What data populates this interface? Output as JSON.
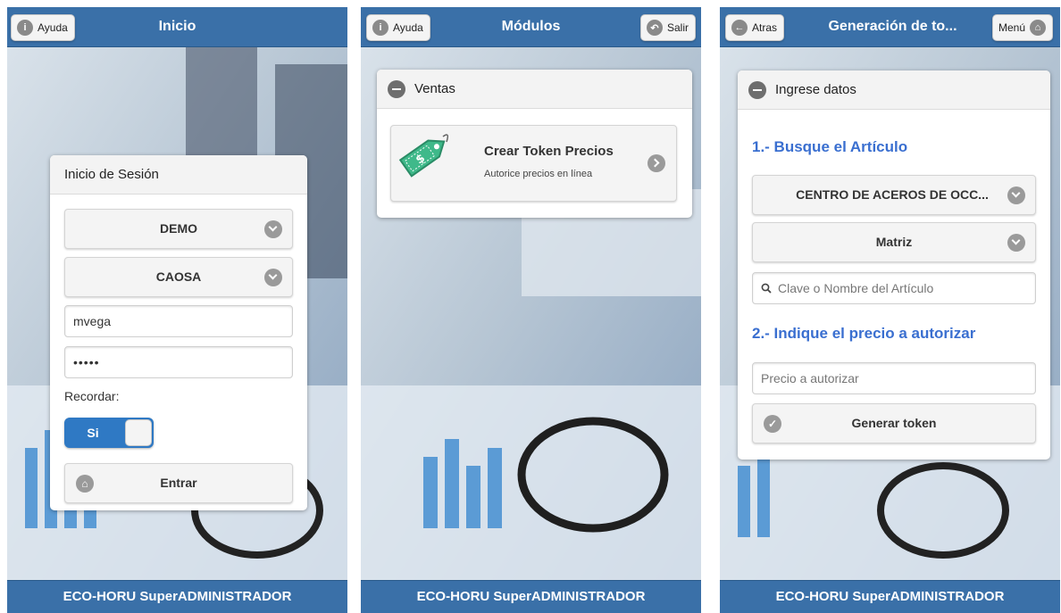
{
  "screens": [
    {
      "header": {
        "title": "Inicio",
        "left_button": {
          "label": "Ayuda",
          "icon": "info-icon"
        }
      },
      "login": {
        "title": "Inicio de Sesión",
        "company_select": "DEMO",
        "branch_select": "CAOSA",
        "username_value": "mvega",
        "password_value": "•••••",
        "remember_label": "Recordar:",
        "remember_toggle": "Si",
        "submit_label": "Entrar"
      },
      "footer": "ECO-HORU SuperADMINISTRADOR"
    },
    {
      "header": {
        "title": "Módulos",
        "left_button": {
          "label": "Ayuda",
          "icon": "info-icon"
        },
        "right_button": {
          "label": "Salir",
          "icon": "exit-icon"
        }
      },
      "section": {
        "title": "Ventas",
        "item": {
          "title": "Crear Token Precios",
          "subtitle": "Autorice precios en línea",
          "icon": "price-tag-icon"
        }
      },
      "footer": "ECO-HORU SuperADMINISTRADOR"
    },
    {
      "header": {
        "title": "Generación de to...",
        "left_button": {
          "label": "Atras",
          "icon": "arrow-left-icon"
        },
        "right_button": {
          "label": "Menú",
          "icon": "home-icon"
        }
      },
      "form": {
        "section_title": "Ingrese datos",
        "step1": "1.- Busque el Artículo",
        "company_select": "CENTRO DE ACEROS DE OCC...",
        "branch_select": "Matriz",
        "search_placeholder": "Clave o Nombre del Artículo",
        "step2": "2.- Indique el precio a autorizar",
        "price_placeholder": "Precio a autorizar",
        "generate_label": "Generar token"
      },
      "footer": "ECO-HORU SuperADMINISTRADOR"
    }
  ],
  "colors": {
    "header": "#3a70a8",
    "accent_blue": "#3a6fd0",
    "toggle": "#2f79c4"
  }
}
